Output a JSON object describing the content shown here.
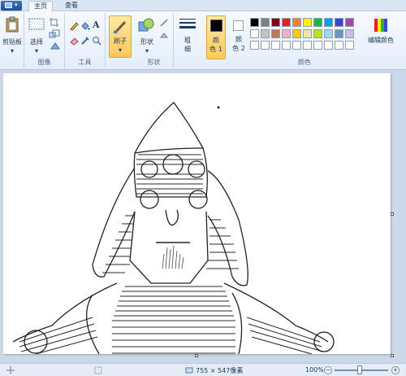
{
  "tabs": [
    {
      "label": "主页"
    },
    {
      "label": "查看"
    }
  ],
  "ribbon": {
    "clipboard": {
      "paste_label": "剪贴板"
    },
    "image": {
      "select_label": "选择",
      "group_label": "图像"
    },
    "tools": {
      "text_tool": "A",
      "group_label": "工具"
    },
    "brushes": {
      "label": "刷子"
    },
    "shapes": {
      "label": "形状",
      "group_label": "形状"
    },
    "size": {
      "label": "粗\n细"
    },
    "colors": {
      "color1_label": "颜\n色 1",
      "color2_label": "颜\n色 2",
      "edit_label": "编辑颜色",
      "group_label": "颜色",
      "palette_row1": [
        "#000000",
        "#7f7f7f",
        "#880015",
        "#ed1c24",
        "#ff7f27",
        "#fff200",
        "#22b14c",
        "#00a2e8",
        "#3f48cc",
        "#a349a4"
      ],
      "palette_row2": [
        "#ffffff",
        "#c3c3c3",
        "#b97a57",
        "#ffaec9",
        "#ffc90e",
        "#efe4b0",
        "#b5e61d",
        "#99d9ea",
        "#7092be",
        "#c8bfe7"
      ],
      "color1": "#000000",
      "color2": "#ffffff"
    }
  },
  "status": {
    "dimensions": "755 × 547像素",
    "zoom": "100%"
  }
}
